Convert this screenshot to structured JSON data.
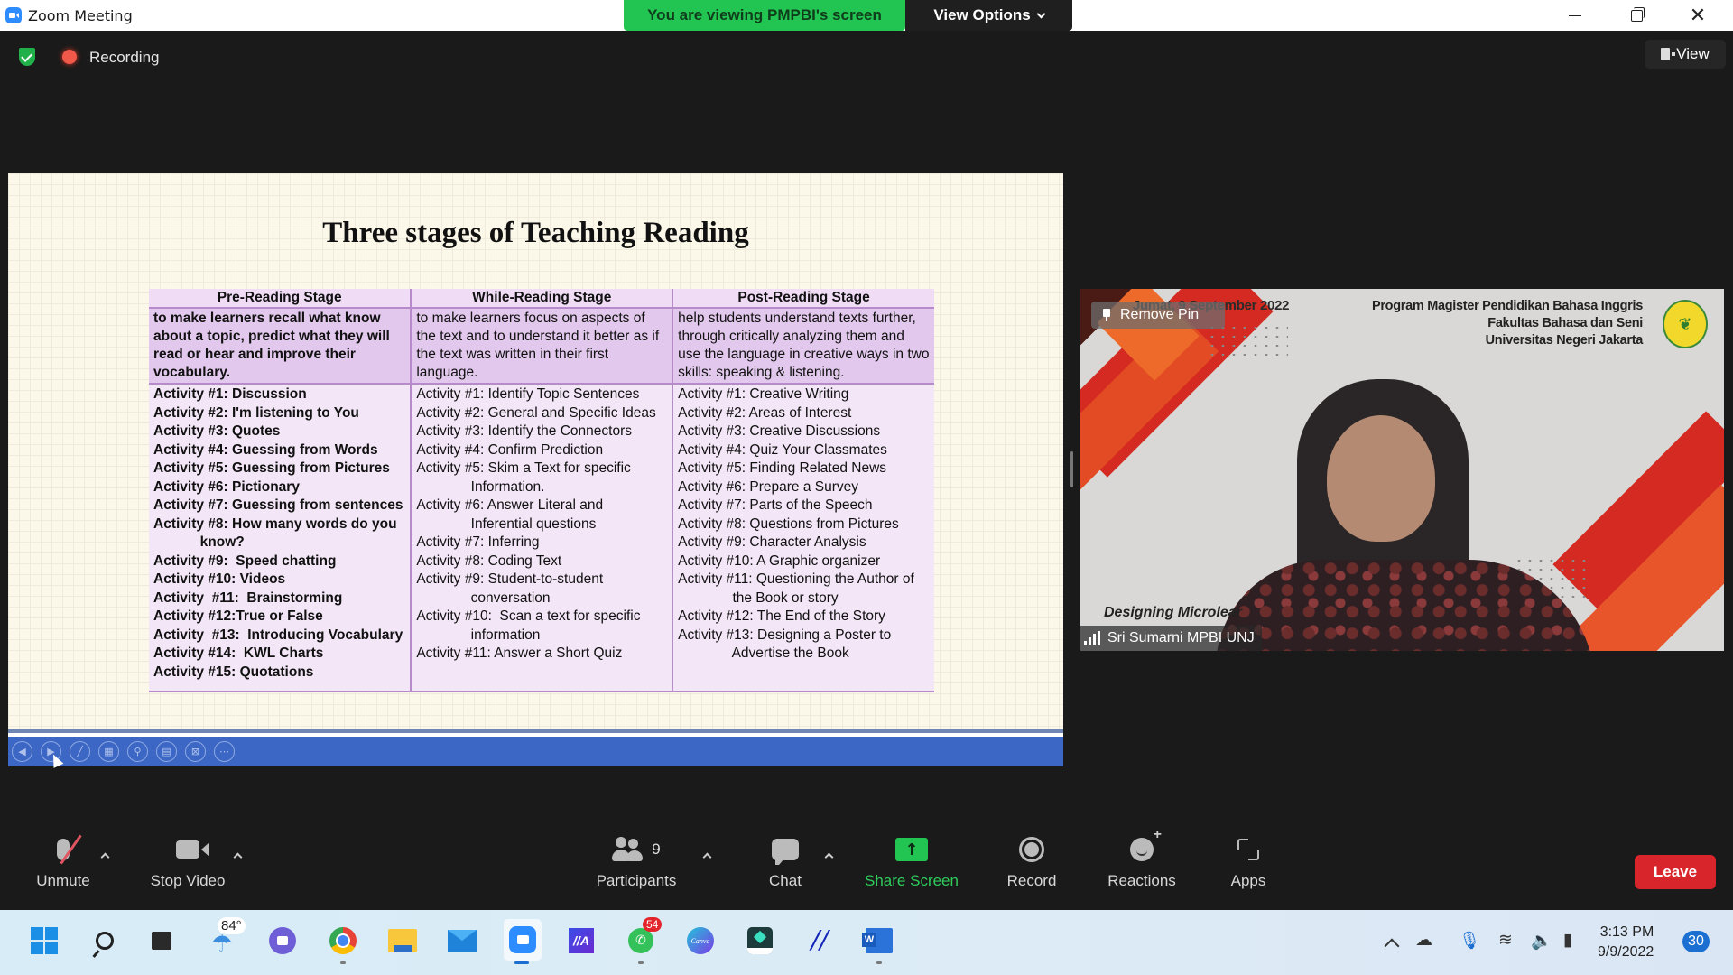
{
  "window": {
    "app_title": "Zoom Meeting",
    "viewing_banner": "You are viewing PMPBI's screen",
    "view_options_label": "View Options"
  },
  "meeting_header": {
    "recording_label": "Recording",
    "view_label": "View"
  },
  "slide": {
    "title": "Three stages of Teaching Reading",
    "columns": [
      {
        "header": "Pre-Reading Stage",
        "purpose": "to make learners recall what know about a topic, predict what they will read or hear and improve their vocabulary.",
        "activities": [
          "Activity #1: Discussion",
          "Activity #2: I'm listening to You",
          "Activity #3: Quotes",
          "Activity #4: Guessing from Words",
          "Activity #5: Guessing from Pictures",
          "Activity #6: Pictionary",
          "Activity #7: Guessing from sentences",
          "Activity #8: How many words do you\n            know?",
          "Activity #9:  Speed chatting",
          "Activity #10: Videos",
          "Activity  #11:  Brainstorming",
          "Activity #12:True or False",
          "Activity  #13:  Introducing Vocabulary",
          "Activity #14:  KWL Charts",
          "Activity #15: Quotations"
        ]
      },
      {
        "header": "While-Reading Stage",
        "purpose": "to make learners  focus on aspects of the text and to understand it better as if the text was written in their first language.",
        "activities": [
          "Activity #1: Identify Topic Sentences",
          "Activity #2: General and Specific Ideas",
          "Activity #3: Identify the Connectors",
          "Activity #4: Confirm Prediction",
          "Activity #5: Skim a Text for specific\n              Information.",
          "Activity #6: Answer Literal and\n              Inferential questions",
          "Activity #7: Inferring",
          "Activity #8: Coding Text",
          "Activity #9: Student-to-student\n              conversation",
          "Activity #10:  Scan a text for specific\n              information",
          "Activity #11: Answer a Short Quiz"
        ]
      },
      {
        "header": "Post-Reading Stage",
        "purpose": "help students understand texts further, through critically analyzing them and use the language in creative ways in two skills: speaking & listening.",
        "activities": [
          "Activity #1: Creative Writing",
          "Activity #2: Areas of Interest",
          "Activity #3: Creative Discussions",
          "Activity #4: Quiz Your Classmates",
          "Activity #5: Finding Related News",
          "Activity #6: Prepare a Survey",
          "Activity #7: Parts of the Speech",
          "Activity #8: Questions from Pictures",
          "Activity #9: Character Analysis",
          "Activity #10: A Graphic organizer",
          "Activity #11: Questioning the Author of\n              the Book or story",
          "Activity #12: The End of the Story",
          "Activity #13: Designing a Poster to\n              Advertise the Book"
        ]
      }
    ],
    "controls": [
      "previous",
      "next",
      "pen",
      "slides",
      "zoom",
      "subtitles",
      "hide",
      "more"
    ]
  },
  "video_tile": {
    "date": "Jumat, 9 September 2022",
    "org_lines": [
      "Program Magister Pendidikan Bahasa Inggris",
      "Fakultas Bahasa dan Seni",
      "Universitas Negeri Jakarta"
    ],
    "remove_pin_label": "Remove Pin",
    "caption": "Designing Microlear",
    "participant_name": "Sri Sumarni MPBI UNJ"
  },
  "toolbar": {
    "unmute_label": "Unmute",
    "stop_video_label": "Stop Video",
    "participants_label": "Participants",
    "participants_count": "9",
    "chat_label": "Chat",
    "share_screen_label": "Share Screen",
    "record_label": "Record",
    "reactions_label": "Reactions",
    "apps_label": "Apps",
    "leave_label": "Leave",
    "share_color": "#23c552",
    "leave_color": "#d7252b"
  },
  "taskbar": {
    "weather_temp": "84°",
    "whatsapp_badge": "54",
    "canva_label": "Canva",
    "time": "3:13 PM",
    "date": "9/9/2022",
    "notification_count": "30"
  }
}
